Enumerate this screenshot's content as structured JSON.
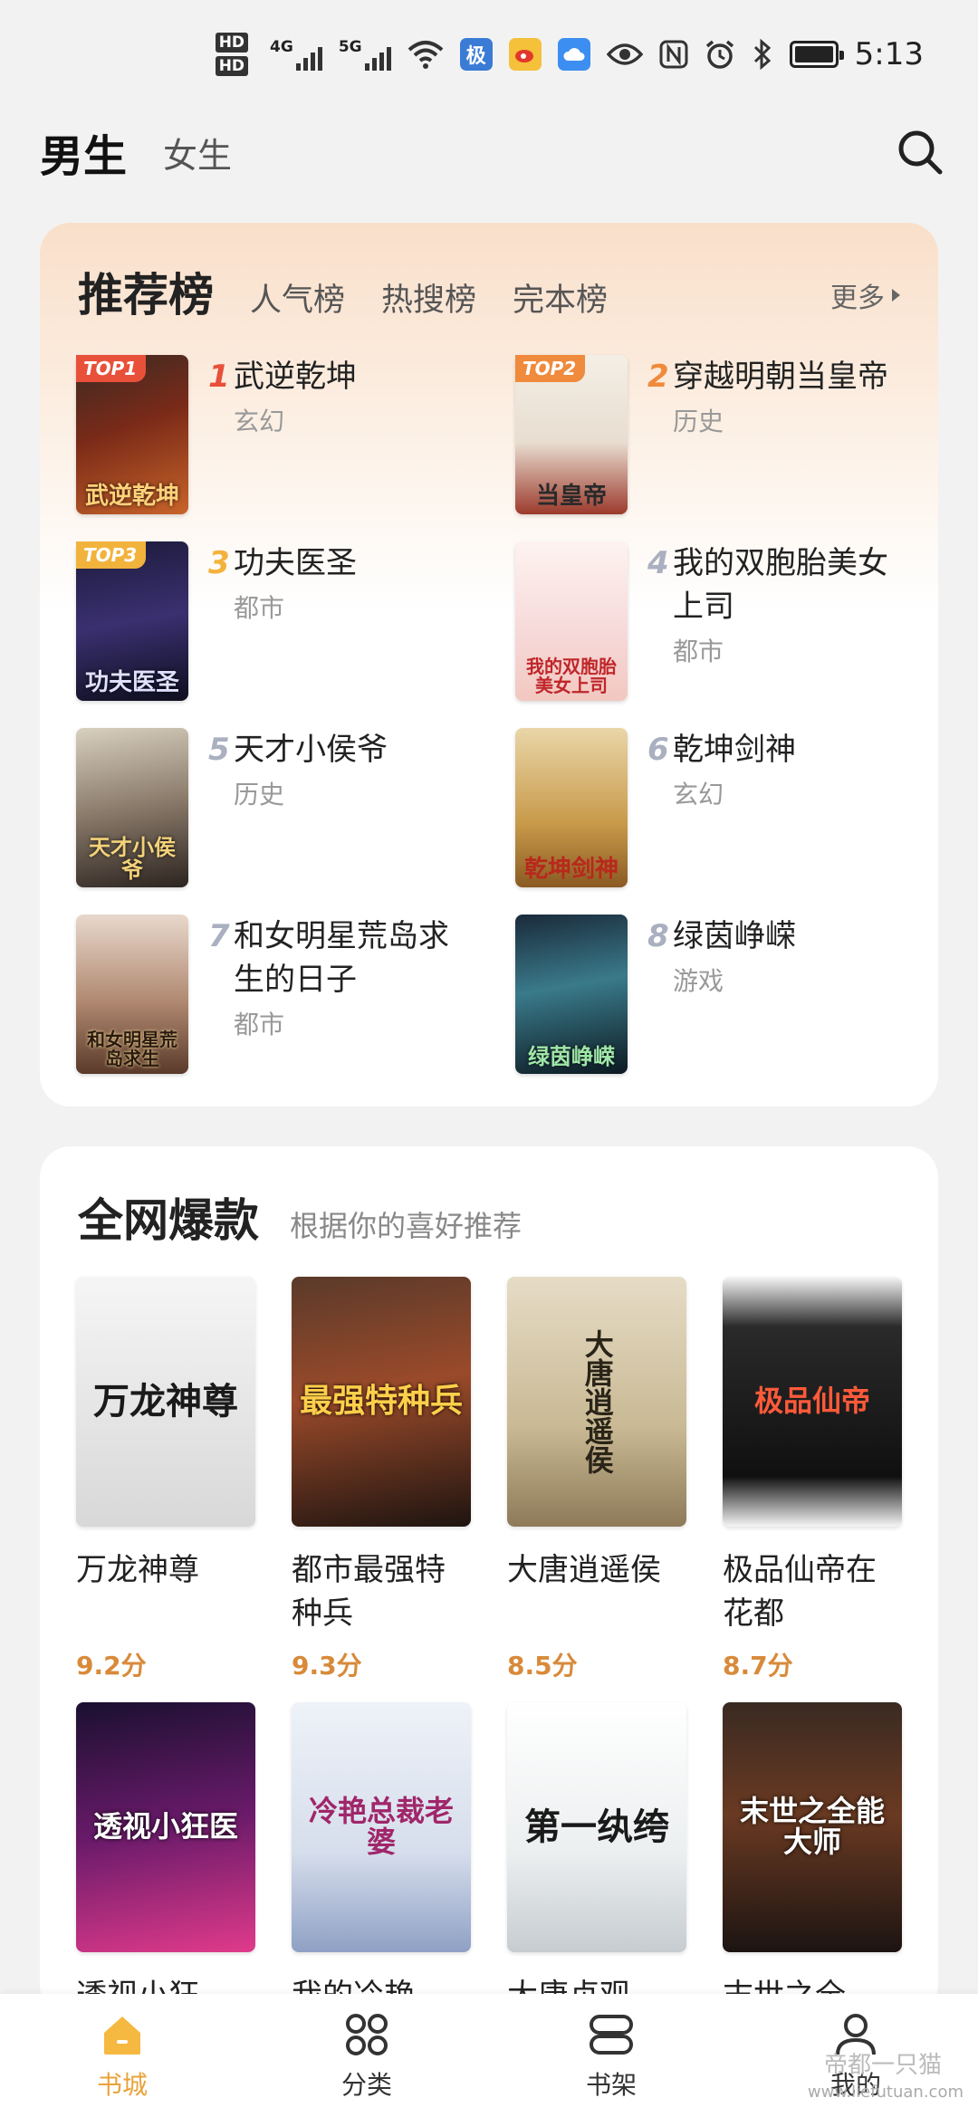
{
  "status_bar": {
    "hd1": "HD",
    "hd2": "HD",
    "sig1": "4G",
    "sig2": "5G",
    "app_icon1": "极",
    "time": "5:13"
  },
  "top_nav": {
    "active_tab": "男生",
    "tab2": "女生"
  },
  "ranking": {
    "title": "推荐榜",
    "tabs": [
      "人气榜",
      "热搜榜",
      "完本榜"
    ],
    "more": "更多",
    "items": [
      {
        "num": "1",
        "badge": "TOP1",
        "name": "武逆乾坤",
        "genre": "玄幻",
        "cover_text": "武逆乾坤"
      },
      {
        "num": "2",
        "badge": "TOP2",
        "name": "穿越明朝当皇帝",
        "genre": "历史",
        "cover_text": "当皇帝"
      },
      {
        "num": "3",
        "badge": "TOP3",
        "name": "功夫医圣",
        "genre": "都市",
        "cover_text": "功夫医圣"
      },
      {
        "num": "4",
        "badge": "",
        "name": "我的双胞胎美女上司",
        "genre": "都市",
        "cover_text": "我的双胞胎美女上司"
      },
      {
        "num": "5",
        "badge": "",
        "name": "天才小侯爷",
        "genre": "历史",
        "cover_text": "天才小侯爷"
      },
      {
        "num": "6",
        "badge": "",
        "name": "乾坤剑神",
        "genre": "玄幻",
        "cover_text": "乾坤剑神"
      },
      {
        "num": "7",
        "badge": "",
        "name": "和女明星荒岛求生的日子",
        "genre": "都市",
        "cover_text": "和女明星荒岛求生"
      },
      {
        "num": "8",
        "badge": "",
        "name": "绿茵峥嵘",
        "genre": "游戏",
        "cover_text": "绿茵峥嵘"
      }
    ]
  },
  "hot": {
    "title": "全网爆款",
    "subtitle": "根据你的喜好推荐",
    "books": [
      {
        "name": "万龙神尊",
        "score": "9.2分",
        "cover_text": "万龙神尊"
      },
      {
        "name": "都市最强特种兵",
        "score": "9.3分",
        "cover_text": "最强特种兵"
      },
      {
        "name": "大唐逍遥侯",
        "score": "8.5分",
        "cover_text": "大唐逍遥侯"
      },
      {
        "name": "极品仙帝在花都",
        "score": "8.7分",
        "cover_text": "极品仙帝"
      }
    ],
    "books_row2": [
      {
        "name": "透视小狂",
        "cover_text": "透视小狂医"
      },
      {
        "name": "我的冷艳",
        "cover_text": "冷艳总裁老婆"
      },
      {
        "name": "大唐贞观",
        "cover_text": "第一纨绔"
      },
      {
        "name": "末世之全",
        "cover_text": "末世之全能大师"
      }
    ]
  },
  "bottom_nav": {
    "items": [
      "书城",
      "分类",
      "书架",
      "我的"
    ]
  },
  "watermark": "帝都一只猫",
  "watermark_url": "www.liefutuan.com",
  "colors": {
    "accent": "#e9a33b",
    "score": "#d88a3a",
    "top1": "#e8503a",
    "top2": "#f08a3c",
    "top3": "#f2b33d"
  }
}
